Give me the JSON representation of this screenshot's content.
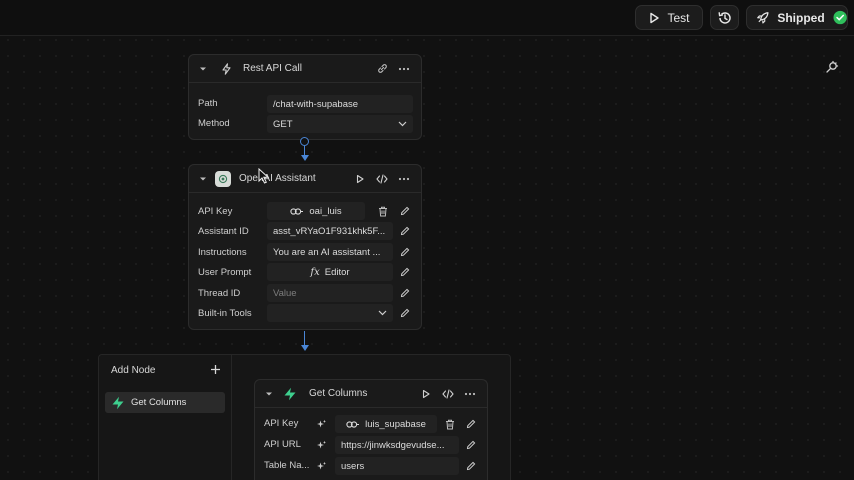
{
  "toolbar": {
    "test_label": "Test",
    "shipped_label": "Shipped"
  },
  "rest_node": {
    "title": "Rest API Call",
    "fields": [
      {
        "label": "Path",
        "value": "/chat-with-supabase"
      },
      {
        "label": "Method",
        "value": "GET"
      }
    ]
  },
  "openai_node": {
    "title": "OpenAI Assistant",
    "fields": [
      {
        "label": "API Key",
        "value": "oai_luis"
      },
      {
        "label": "Assistant ID",
        "value": "asst_vRYaO1F931khk5F..."
      },
      {
        "label": "Instructions",
        "value": "You are an AI assistant ..."
      },
      {
        "label": "User Prompt",
        "value": "Editor"
      },
      {
        "label": "Thread ID",
        "placeholder": "Value"
      },
      {
        "label": "Built-in Tools",
        "value": ""
      }
    ]
  },
  "add_node_panel": {
    "title": "Add Node",
    "items": [
      {
        "label": "Get Columns"
      }
    ]
  },
  "columns_node": {
    "title": "Get Columns",
    "fields": [
      {
        "label": "API Key",
        "value": "luis_supabase"
      },
      {
        "label": "API URL",
        "value": "https://jinwksdgevudse..."
      },
      {
        "label": "Table Na...",
        "value": "users"
      }
    ]
  },
  "colors": {
    "accent_blue": "#4a86d6",
    "success_green": "#2fbf5c",
    "supabase_green": "#3ecf8e"
  }
}
